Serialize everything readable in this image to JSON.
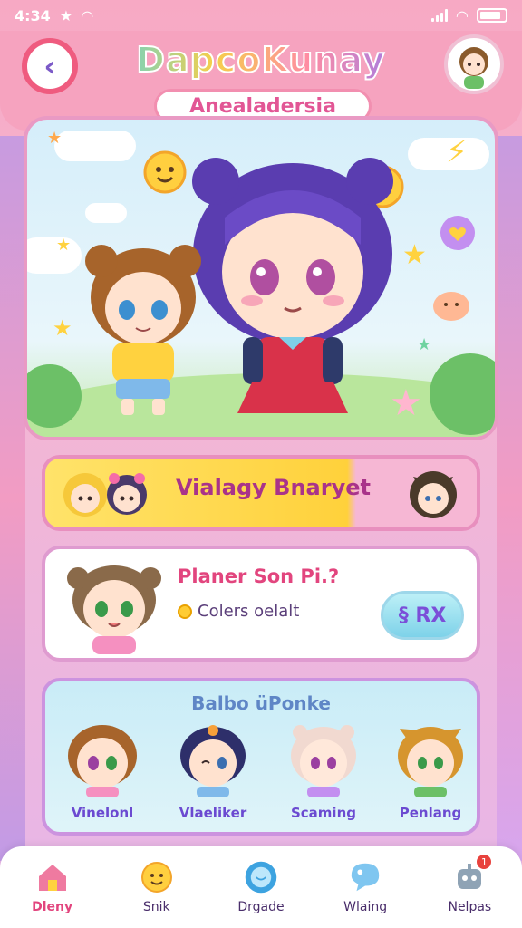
{
  "status_bar": {
    "time": "4:34",
    "signal_icon": "signal-icon",
    "wifi_icon": "wifi-icon",
    "battery_icon": "battery-icon"
  },
  "header": {
    "title": "DapcoKunay",
    "subtitle": "Anealadersia",
    "back_icon": "back-arrow-icon",
    "avatar_icon": "profile-avatar-icon"
  },
  "banner": {
    "label": "Vialagy Bnaryet"
  },
  "info_card": {
    "title": "Planer Son Pi.?",
    "subtitle": "Colers oelalt",
    "button_label": "§ RX"
  },
  "select_panel": {
    "title": "Balbo üPonke",
    "characters": [
      {
        "name": "Vinelonl"
      },
      {
        "name": "Vlaeliker"
      },
      {
        "name": "Scaming"
      },
      {
        "name": "Penlang"
      }
    ]
  },
  "bottom_nav": {
    "items": [
      {
        "label": "Dleny",
        "icon": "home-icon",
        "active": true
      },
      {
        "label": "Snik",
        "icon": "face-icon",
        "active": false
      },
      {
        "label": "Drgade",
        "icon": "chat-bubble-icon",
        "active": false
      },
      {
        "label": "Wlaing",
        "icon": "bubble-icon",
        "active": false
      },
      {
        "label": "Nelpas",
        "icon": "robot-icon",
        "active": false,
        "badge": "1"
      }
    ]
  },
  "colors": {
    "accent": "#e2457e",
    "brand_pink": "#f6a3bf",
    "panel_border": "#df9bd0"
  }
}
